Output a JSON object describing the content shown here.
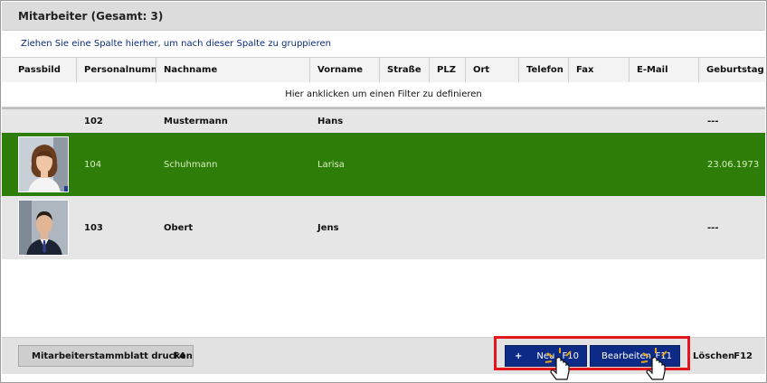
{
  "window": {
    "title": "Mitarbeiter (Gesamt: 3)"
  },
  "grid": {
    "group_hint": "Ziehen Sie eine Spalte hierher, um nach dieser Spalte zu gruppieren",
    "filter_hint": "Hier anklicken um einen Filter zu definieren",
    "columns": [
      "Passbild",
      "Personalnumme",
      "Nachname",
      "Vorname",
      "Straße",
      "PLZ",
      "Ort",
      "Telefon",
      "Fax",
      "E-Mail",
      "Geburtstag"
    ],
    "rows": [
      {
        "personalnummer": "102",
        "nachname": "Mustermann",
        "vorname": "Hans",
        "geburtstag": "---",
        "selected": false,
        "photo": "none"
      },
      {
        "personalnummer": "104",
        "nachname": "Schuhmann",
        "vorname": "Larisa",
        "geburtstag": "23.06.1973",
        "selected": true,
        "photo": "woman-portrait"
      },
      {
        "personalnummer": "103",
        "nachname": "Obert",
        "vorname": "Jens",
        "geburtstag": "---",
        "selected": false,
        "photo": "man-portrait"
      }
    ]
  },
  "actions": {
    "print": {
      "label": "Mitarbeiterstammblatt drucken",
      "shortcut": "F4"
    },
    "new": {
      "icon": "+",
      "label": "Neu",
      "shortcut": "F10"
    },
    "edit": {
      "label": "Bearbeiten",
      "shortcut": "F11"
    },
    "delete": {
      "label": "Löschen",
      "shortcut": "F12"
    }
  },
  "colors": {
    "selected_row": "#2f7d09",
    "primary_button": "#0c2a86",
    "highlight": "#e4161d"
  }
}
